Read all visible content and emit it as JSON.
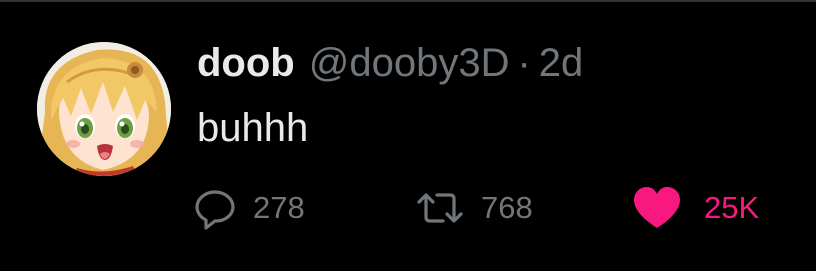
{
  "tweet": {
    "display_name": "doob",
    "handle": "@dooby3D",
    "separator": "·",
    "time": "2d",
    "text": "buhhh"
  },
  "actions": {
    "reply_count": "278",
    "retweet_count": "768",
    "like_count": "25K",
    "liked": true
  },
  "colors": {
    "background": "#000000",
    "text_primary": "#e7e9ea",
    "text_secondary": "#71767b",
    "like_active": "#f91880"
  },
  "icons": {
    "reply": "reply-icon",
    "retweet": "retweet-icon",
    "like": "heart-filled-icon"
  }
}
